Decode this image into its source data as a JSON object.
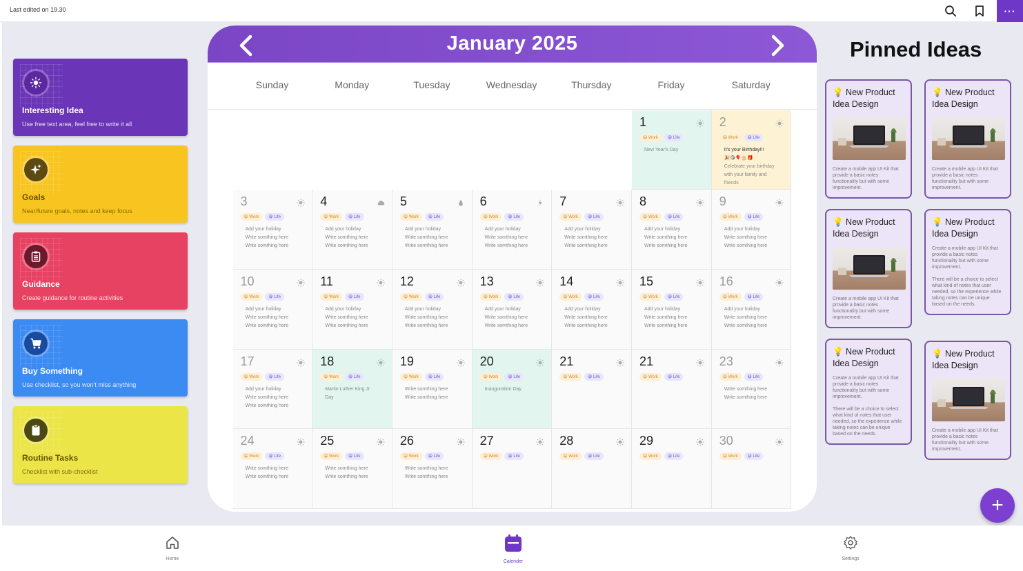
{
  "topbar": {
    "last_edited": "Last edited on 19.30",
    "more_label": "···"
  },
  "cards": [
    {
      "title": "Interesting Idea",
      "subtitle": "Use free text area, feel free to write it all",
      "bg": "#6a35b6",
      "icon": "lightbulb-icon",
      "icon_bg": "#5b28a0"
    },
    {
      "title": "Goals",
      "subtitle": "Near/future goals, notes and keep focus",
      "bg": "#f8c520",
      "icon": "sparkle-icon",
      "icon_bg": "#5d4a10"
    },
    {
      "title": "Guidance",
      "subtitle": "Create guidance for routine activities",
      "bg": "#e84263",
      "icon": "clipboard-icon",
      "icon_bg": "#6a1a2a"
    },
    {
      "title": "Buy Something",
      "subtitle": "Use checklist, so you won't miss anything",
      "bg": "#3c8bf2",
      "icon": "cart-icon",
      "icon_bg": "#1a4aa0"
    },
    {
      "title": "Routine Tasks",
      "subtitle": "Checklist with sub-checklist",
      "bg": "#ebe548",
      "icon": "checklist-icon",
      "icon_bg": "#4c4a12"
    }
  ],
  "calendar": {
    "month": "January 2025",
    "weekdays": [
      "Sunday",
      "Monday",
      "Tuesday",
      "Wednesday",
      "Thursday",
      "Friday",
      "Saturday"
    ],
    "days": [
      {
        "num": "1",
        "weather": "sun",
        "muted": false,
        "bg": "green",
        "tags": [
          "😄 Work",
          "😆 Life"
        ],
        "notes": [
          "New Year's Day"
        ]
      },
      {
        "num": "2",
        "weather": "sun",
        "muted": true,
        "bg": "yellow",
        "tags": [
          "😄 Work",
          "😆 Life"
        ],
        "notes": [
          "It's your Birthday!!!",
          "🎉😘🎈🎂🎁",
          "Celebrate your birthday",
          "with your family and",
          "friends"
        ]
      },
      {
        "num": "3",
        "weather": "sun",
        "muted": true,
        "bg": "",
        "tags": [
          "😄 Work",
          "😆 Life"
        ],
        "notes": [
          "Add your holiday",
          "Write somthing here",
          "Write somthing here"
        ]
      },
      {
        "num": "4",
        "weather": "cloud",
        "muted": false,
        "bg": "",
        "tags": [
          "😄 Work",
          "😆 Life"
        ],
        "notes": [
          "Add your holiday",
          "Write somthing here",
          "Write somthing here"
        ]
      },
      {
        "num": "5",
        "weather": "rain",
        "muted": false,
        "bg": "",
        "tags": [
          "😄 Work",
          "😆 Life"
        ],
        "notes": [
          "Add your holiday",
          "Write somthing here",
          "Write somthing here"
        ]
      },
      {
        "num": "6",
        "weather": "storm",
        "muted": false,
        "bg": "",
        "tags": [
          "😄 Work",
          "😆 Life"
        ],
        "notes": [
          "Add your holiday",
          "Write somthing here",
          "Write somthing here"
        ]
      },
      {
        "num": "7",
        "weather": "sun",
        "muted": false,
        "bg": "",
        "tags": [
          "😄 Work",
          "😆 Life"
        ],
        "notes": [
          "Add your holiday",
          "Write somthing here",
          "Write somthing here"
        ]
      },
      {
        "num": "8",
        "weather": "sun",
        "muted": false,
        "bg": "",
        "tags": [
          "😄 Work",
          "😆 Life"
        ],
        "notes": [
          "Add your holiday",
          "Write somthing here",
          "Write somthing here"
        ]
      },
      {
        "num": "9",
        "weather": "sun",
        "muted": true,
        "bg": "",
        "tags": [
          "😄 Work",
          "😆 Life"
        ],
        "notes": [
          "Add your holiday",
          "Write somthing here",
          "Write somthing here"
        ]
      },
      {
        "num": "10",
        "weather": "sun",
        "muted": true,
        "bg": "",
        "tags": [
          "😄 Work",
          "😆 Life"
        ],
        "notes": [
          "Add your holiday",
          "Write somthing here",
          "Write somthing here"
        ]
      },
      {
        "num": "11",
        "weather": "sun",
        "muted": false,
        "bg": "",
        "tags": [
          "😄 Work",
          "😆 Life"
        ],
        "notes": [
          "Add your holiday",
          "Write somthing here",
          "Write somthing here"
        ]
      },
      {
        "num": "12",
        "weather": "sun",
        "muted": false,
        "bg": "",
        "tags": [
          "😄 Work",
          "😆 Life"
        ],
        "notes": [
          "Add your holiday",
          "Write somthing here",
          "Write somthing here"
        ]
      },
      {
        "num": "13",
        "weather": "sun",
        "muted": false,
        "bg": "",
        "tags": [
          "😄 Work",
          "😆 Life"
        ],
        "notes": [
          "Add your holiday",
          "Write somthing here",
          "Write somthing here"
        ]
      },
      {
        "num": "14",
        "weather": "sun",
        "muted": false,
        "bg": "",
        "tags": [
          "😄 Work",
          "😆 Life"
        ],
        "notes": [
          "Add your holiday",
          "Write somthing here",
          "Write somthing here"
        ]
      },
      {
        "num": "15",
        "weather": "sun",
        "muted": false,
        "bg": "",
        "tags": [
          "😄 Work",
          "😆 Life"
        ],
        "notes": [
          "Add your holiday",
          "Write somthing here",
          "Write somthing here"
        ]
      },
      {
        "num": "16",
        "weather": "sun",
        "muted": true,
        "bg": "",
        "tags": [
          "😄 Work",
          "😆 Life"
        ],
        "notes": [
          "Add your holiday",
          "Write somthing here",
          "Write somthing here"
        ]
      },
      {
        "num": "17",
        "weather": "sun",
        "muted": true,
        "bg": "",
        "tags": [
          "😄 Work",
          "😆 Life"
        ],
        "notes": [
          "Add your holiday",
          "Write somthing here",
          "Write somthing here"
        ]
      },
      {
        "num": "18",
        "weather": "sun",
        "muted": false,
        "bg": "green",
        "tags": [
          "😄 Work",
          "😆 Life"
        ],
        "notes": [
          "Martin Luther King Jr.",
          "Day"
        ]
      },
      {
        "num": "19",
        "weather": "sun",
        "muted": false,
        "bg": "",
        "tags": [
          "😄 Work",
          "😆 Life"
        ],
        "notes": [
          "Write somthing here",
          "Write somthing here"
        ]
      },
      {
        "num": "20",
        "weather": "sun",
        "muted": false,
        "bg": "green",
        "tags": [
          "😄 Work",
          "😆 Life"
        ],
        "notes": [
          "Inauguration Day"
        ]
      },
      {
        "num": "21",
        "weather": "sun",
        "muted": false,
        "bg": "",
        "tags": [
          "😄 Work",
          "😆 Life"
        ],
        "notes": []
      },
      {
        "num": "21",
        "weather": "sun",
        "muted": false,
        "bg": "",
        "tags": [
          "😄 Work",
          "😆 Life"
        ],
        "notes": []
      },
      {
        "num": "23",
        "weather": "sun",
        "muted": true,
        "bg": "",
        "tags": [
          "😄 Work",
          "😆 Life"
        ],
        "notes": [
          "Write somthing here",
          "Write somthing here"
        ]
      },
      {
        "num": "24",
        "weather": "sun",
        "muted": true,
        "bg": "",
        "tags": [
          "😄 Work",
          "😆 Life"
        ],
        "notes": [
          "Write somthing here",
          "Write somthing here"
        ]
      },
      {
        "num": "25",
        "weather": "sun",
        "muted": false,
        "bg": "",
        "tags": [
          "😄 Work",
          "😆 Life"
        ],
        "notes": [
          "Write somthing here",
          "Write somthing here"
        ]
      },
      {
        "num": "26",
        "weather": "sun",
        "muted": false,
        "bg": "",
        "tags": [
          "😄 Work",
          "😆 Life"
        ],
        "notes": [
          "Write somthing here",
          "Write somthing here"
        ]
      },
      {
        "num": "27",
        "weather": "sun",
        "muted": false,
        "bg": "",
        "tags": [
          "😄 Work",
          "😆 Life"
        ],
        "notes": []
      },
      {
        "num": "28",
        "weather": "sun",
        "muted": false,
        "bg": "",
        "tags": [
          "😄 Work",
          "😆 Life"
        ],
        "notes": []
      },
      {
        "num": "29",
        "weather": "sun",
        "muted": false,
        "bg": "",
        "tags": [
          "😄 Work",
          "😆 Life"
        ],
        "notes": []
      },
      {
        "num": "30",
        "weather": "sun",
        "muted": true,
        "bg": "",
        "tags": [
          "😄 Work",
          "😆 Life"
        ],
        "notes": []
      }
    ]
  },
  "pinned": {
    "title": "Pinned Ideas",
    "cards": [
      {
        "title": "💡 New Product Idea Design",
        "image": true,
        "texts": [
          "Create a mobile app UI Kit that provide a basic notes functionality but with some improvement."
        ]
      },
      {
        "title": "💡 New Product Idea Design",
        "image": true,
        "texts": [
          "Create a mobile app UI Kit that provide a basic notes functionality but with some improvement."
        ]
      },
      {
        "title": "💡 New Product Idea Design",
        "image": true,
        "texts": [
          "Create a mobile app UI Kit that provide a basic notes functionality but with some improvement."
        ]
      },
      {
        "title": "💡 New Product Idea Design",
        "image": false,
        "texts": [
          "Create a mobile app UI Kit that provide a basic notes functionality but with some improvement.",
          "There will be a choice to select what kind of notes that user needed, so the experience while taking notes can be unique based on the needs."
        ]
      },
      {
        "title": "💡 New Product Idea Design",
        "image": false,
        "texts": [
          "Create a mobile app UI Kit that provide a basic notes functionality but with some improvement.",
          "There will be a choice to select what kind of notes that user needed, so the experience while taking notes can be unique based on the needs."
        ]
      },
      {
        "title": "💡 New Product Idea Design",
        "image": true,
        "texts": [
          "Create a mobile app UI Kit that provide a basic notes functionality but with some improvement."
        ]
      }
    ]
  },
  "fab": {
    "label": "+"
  },
  "bottom_nav": [
    {
      "label": "Home",
      "icon": "home-icon",
      "active": false
    },
    {
      "label": "Calender",
      "icon": "calendar-icon",
      "active": true
    },
    {
      "label": "Settings",
      "icon": "settings-icon",
      "active": false
    }
  ]
}
